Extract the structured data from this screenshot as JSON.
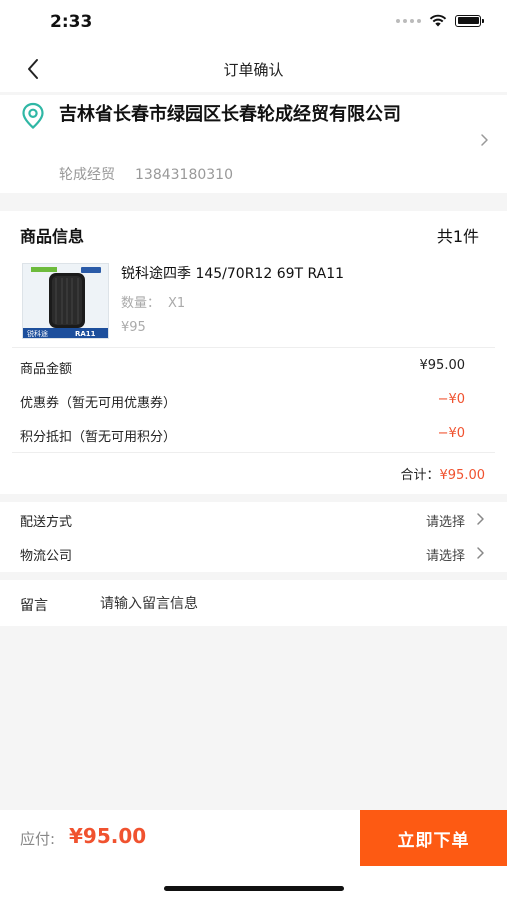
{
  "status_bar": {
    "time": "2:33"
  },
  "nav": {
    "title": "订单确认"
  },
  "address": {
    "line": "吉林省长春市绿园区长春轮成经贸有限公司",
    "name": "轮成经贸",
    "phone": "13843180310"
  },
  "goods": {
    "section_title": "商品信息",
    "count": "共1件",
    "product": {
      "name": "锐科途四季 145/70R12 69T RA11",
      "qty_label": "数量：",
      "qty_value": "X1",
      "price": "¥95",
      "image_brand": "锐科途",
      "image_model": "RA11"
    },
    "fees": [
      {
        "label": "商品金额",
        "value": "¥95.00",
        "red": false
      },
      {
        "label": "优惠券（暂无可用优惠券）",
        "value": "−¥0",
        "red": true
      },
      {
        "label": "积分抵扣（暂无可用积分）",
        "value": "−¥0",
        "red": true
      }
    ],
    "total_label": "合计：",
    "total_value": "¥95.00"
  },
  "delivery": {
    "method_label": "配送方式",
    "method_value": "请选择",
    "logistics_label": "物流公司",
    "logistics_value": "请选择"
  },
  "remark": {
    "label": "留言",
    "placeholder": "请输入留言信息"
  },
  "bottom": {
    "pay_label": "应付:",
    "pay_amount": "¥95.00",
    "submit_label": "立即下单"
  },
  "colors": {
    "accent": "#fd5a13",
    "price_red": "#f0522f",
    "location_icon": "#2fb7a5"
  }
}
